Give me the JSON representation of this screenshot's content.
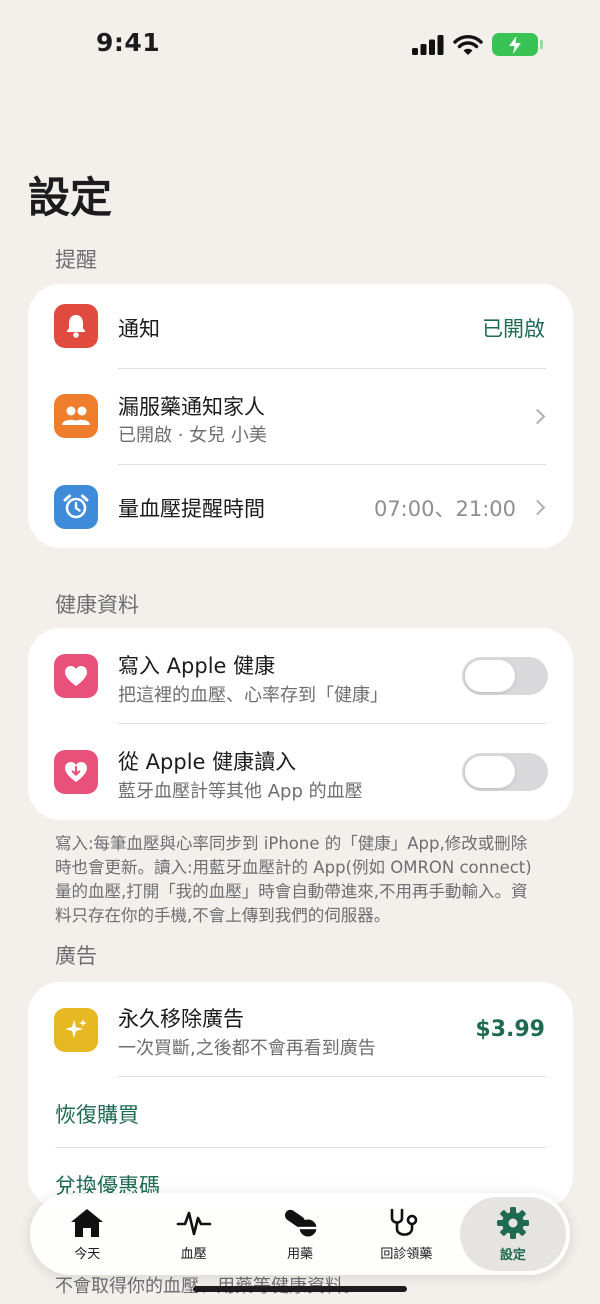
{
  "status": {
    "time": "9:41"
  },
  "page": {
    "title": "設定"
  },
  "reminders": {
    "header": "提醒",
    "notification": {
      "title": "通知",
      "value": "已開啟"
    },
    "family": {
      "title": "漏服藥通知家人",
      "subtitle": "已開啟 · 女兒 小美"
    },
    "bp_time": {
      "title": "量血壓提醒時間",
      "value": "07:00、21:00"
    }
  },
  "health": {
    "header": "健康資料",
    "write": {
      "title": "寫入 Apple 健康",
      "subtitle": "把這裡的血壓、心率存到「健康」",
      "enabled": false
    },
    "read": {
      "title": "從 Apple 健康讀入",
      "subtitle": "藍牙血壓計等其他 App 的血壓",
      "enabled": false
    },
    "footnote": "寫入:每筆血壓與心率同步到 iPhone 的「健康」App,修改或刪除時也會更新。讀入:用藍牙血壓計的 App(例如 OMRON connect) 量的血壓,打開「我的血壓」時會自動帶進來,不用再手動輸入。資料只存在你的手機,不會上傳到我們的伺服器。"
  },
  "ads": {
    "header": "廣告",
    "remove": {
      "title": "永久移除廣告",
      "subtitle": "一次買斷,之後都不會再看到廣告",
      "price": "$3.99"
    },
    "restore": "恢復購買",
    "redeem": "兌換優惠碼",
    "obscured_footer": "不會取得你的血壓、用藥等健康資料。"
  },
  "tabs": [
    {
      "label": "今天",
      "icon": "house-icon"
    },
    {
      "label": "血壓",
      "icon": "waveform-icon"
    },
    {
      "label": "用藥",
      "icon": "pills-icon"
    },
    {
      "label": "回診領藥",
      "icon": "stethoscope-icon"
    },
    {
      "label": "設定",
      "icon": "gear-icon",
      "active": true
    }
  ],
  "colors": {
    "accent": "#1f6b52",
    "bell": "#e04a3f",
    "family": "#ee7d2c",
    "alarm": "#3d8bd9",
    "heart": "#e9517a",
    "sparkle": "#e6b923",
    "background": "#f3f0eb"
  }
}
